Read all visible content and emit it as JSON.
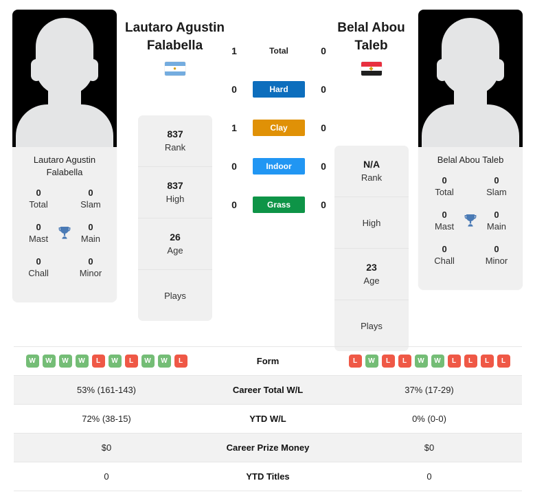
{
  "players": {
    "left": {
      "name": "Lautaro Agustin Falabella",
      "name_line1": "Lautaro Agustin",
      "name_line2": "Falabella",
      "card_name_line1": "Lautaro Agustin",
      "card_name_line2": "Falabella",
      "flag": "argentina-flag",
      "rank": "837",
      "rank_label": "Rank",
      "high": "837",
      "high_label": "High",
      "age": "26",
      "age_label": "Age",
      "plays": "",
      "plays_label": "Plays",
      "titles": {
        "total": "0",
        "total_label": "Total",
        "slam": "0",
        "slam_label": "Slam",
        "mast": "0",
        "mast_label": "Mast",
        "main": "0",
        "main_label": "Main",
        "chall": "0",
        "chall_label": "Chall",
        "minor": "0",
        "minor_label": "Minor"
      },
      "form": [
        "W",
        "W",
        "W",
        "W",
        "L",
        "W",
        "L",
        "W",
        "W",
        "L"
      ],
      "career_total_wl": "53% (161-143)",
      "ytd_wl": "72% (38-15)",
      "career_prize_money": "$0",
      "ytd_titles": "0"
    },
    "right": {
      "name": "Belal Abou Taleb",
      "name_line1": "Belal Abou",
      "name_line2": "Taleb",
      "card_name_line1": "Belal Abou Taleb",
      "card_name_line2": "",
      "flag": "egypt-flag",
      "rank": "N/A",
      "rank_label": "Rank",
      "high": "",
      "high_label": "High",
      "age": "23",
      "age_label": "Age",
      "plays": "",
      "plays_label": "Plays",
      "titles": {
        "total": "0",
        "total_label": "Total",
        "slam": "0",
        "slam_label": "Slam",
        "mast": "0",
        "mast_label": "Mast",
        "main": "0",
        "main_label": "Main",
        "chall": "0",
        "chall_label": "Chall",
        "minor": "0",
        "minor_label": "Minor"
      },
      "form": [
        "L",
        "W",
        "L",
        "L",
        "W",
        "W",
        "L",
        "L",
        "L",
        "L"
      ],
      "career_total_wl": "37% (17-29)",
      "ytd_wl": "0% (0-0)",
      "career_prize_money": "$0",
      "ytd_titles": "0"
    }
  },
  "h2h": [
    {
      "label": "Total",
      "left": "1",
      "right": "0",
      "color": "",
      "text_color": "#222222",
      "plain": true
    },
    {
      "label": "Hard",
      "left": "0",
      "right": "0",
      "color": "#0d6ebd",
      "text_color": "#ffffff",
      "plain": false
    },
    {
      "label": "Clay",
      "left": "1",
      "right": "0",
      "color": "#e09106",
      "text_color": "#ffffff",
      "plain": false
    },
    {
      "label": "Indoor",
      "left": "0",
      "right": "0",
      "color": "#2196f3",
      "text_color": "#ffffff",
      "plain": false
    },
    {
      "label": "Grass",
      "left": "0",
      "right": "0",
      "color": "#0e9447",
      "text_color": "#ffffff",
      "plain": false
    }
  ],
  "table_rows": [
    {
      "label": "Form",
      "shaded": false
    },
    {
      "label": "Career Total W/L",
      "shaded": true
    },
    {
      "label": "YTD W/L",
      "shaded": false
    },
    {
      "label": "Career Prize Money",
      "shaded": true
    },
    {
      "label": "YTD Titles",
      "shaded": false
    }
  ],
  "colors": {
    "win": "#74bd76",
    "loss": "#ef5846",
    "trophy": "#4a7ab5",
    "card_bg": "#f0f0f0",
    "row_shade": "#f2f2f2"
  },
  "icons": {
    "trophy": "trophy-icon",
    "avatar": "avatar-silhouette"
  }
}
